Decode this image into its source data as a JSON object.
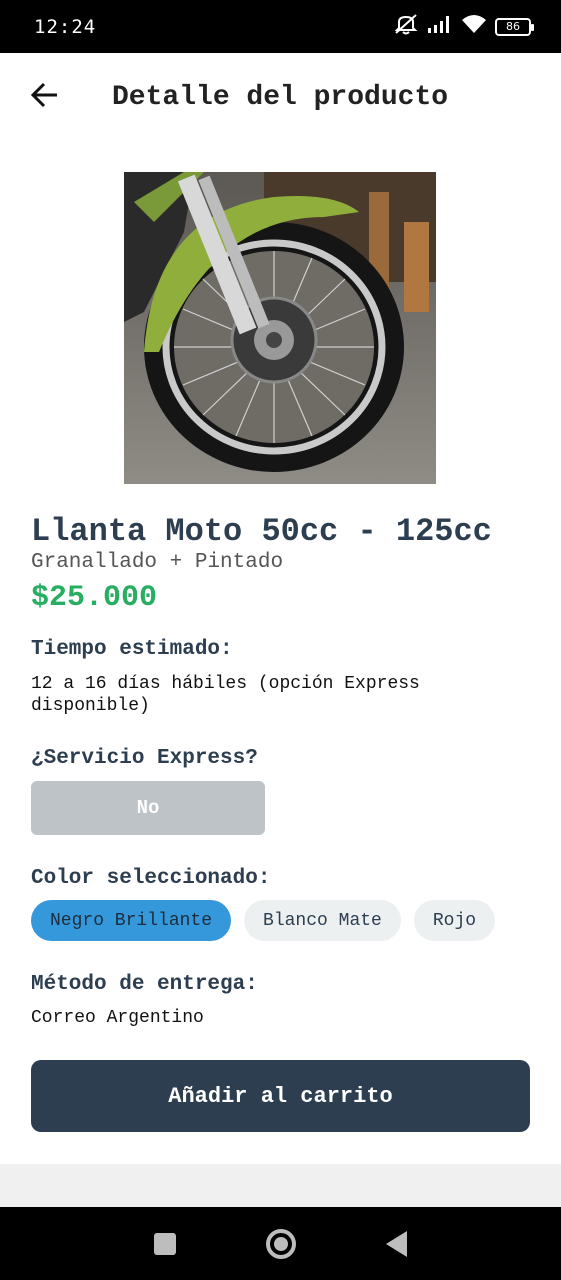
{
  "status_bar": {
    "time": "12:24",
    "battery": "86",
    "icons": [
      "mute-icon",
      "signal-icon",
      "wifi-icon",
      "battery-icon"
    ]
  },
  "app_bar": {
    "back_icon": "arrow-left-icon",
    "title": "Detalle del producto"
  },
  "product": {
    "image_alt": "motorcycle-wheel-photo",
    "title": "Llanta Moto 50cc - 125cc",
    "subtitle": "Granallado + Pintado",
    "price": "$25.000"
  },
  "estimated_time": {
    "label": "Tiempo estimado:",
    "value": "12 a 16 días hábiles (opción Express disponible)"
  },
  "express": {
    "label": "¿Servicio Express?",
    "button": "No"
  },
  "color": {
    "label": "Color seleccionado:",
    "options": [
      "Negro Brillante",
      "Blanco Mate",
      "Rojo"
    ],
    "selected": "Negro Brillante"
  },
  "delivery": {
    "label": "Método de entrega:",
    "value": "Correo Argentino"
  },
  "cart_button": "Añadir al carrito",
  "colors": {
    "primary": "#2c3e50",
    "price": "#27ae60",
    "chip_selected": "#3498db",
    "chip_unselected": "#ecf0f1",
    "disabled_button": "#bdc3c7"
  },
  "nav_bar": [
    "recents-square-icon",
    "home-circle-icon",
    "back-triangle-icon"
  ]
}
